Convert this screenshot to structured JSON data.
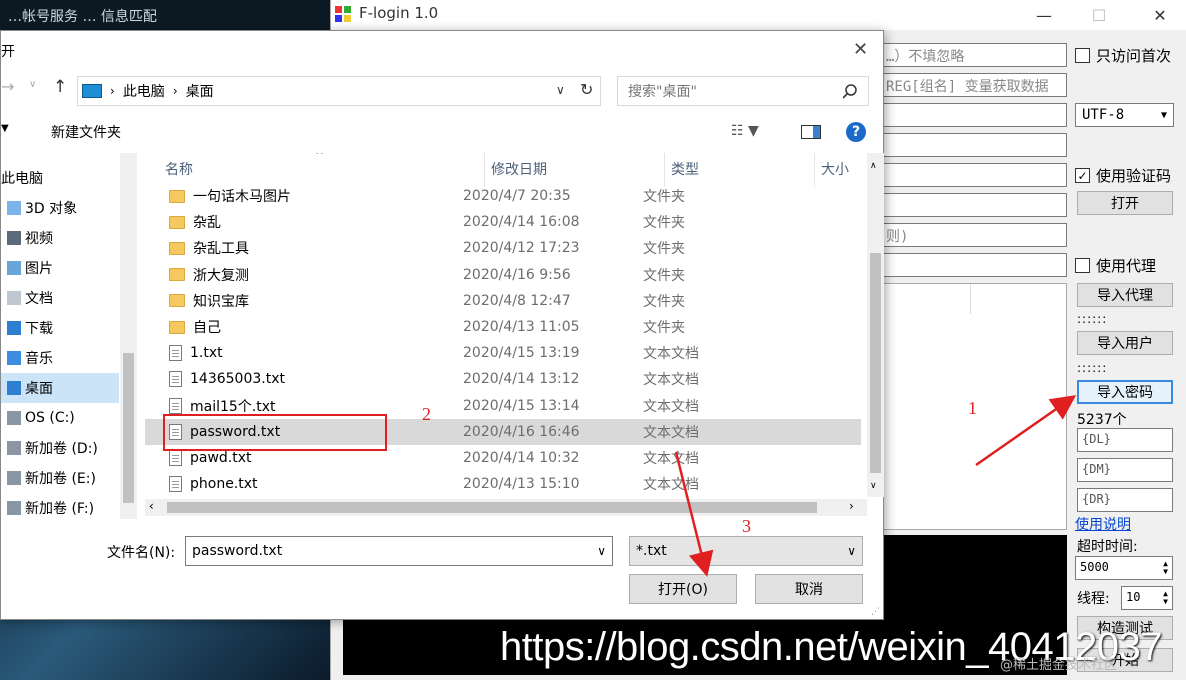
{
  "desktop": {
    "title_text": "…帐号服务 … 信息匹配"
  },
  "flogin": {
    "title": "F-login 1.0",
    "inputs": [
      "…）不填忽略",
      "REG[组名] 变量获取数据",
      "",
      "",
      "",
      "",
      "则)",
      ""
    ],
    "only_first": "只访问首次",
    "encoding": "UTF-8",
    "use_captcha": "使用验证码",
    "open_btn": "打开",
    "use_proxy": "使用代理",
    "import_proxy": "导入代理",
    "dots1": "::::::",
    "import_user": "导入用户",
    "dots2": "::::::",
    "import_pwd": "导入密码",
    "count": "5237个",
    "dl": "{DL}",
    "dm": "{DM}",
    "dr": "{DR}",
    "usage": "使用说明",
    "timeout_label": "超时时间:",
    "timeout_value": "5000",
    "threads_label": "线程:",
    "threads_value": "10",
    "build_test": "构造测试",
    "start": "开始"
  },
  "dialog": {
    "title": "开",
    "breadcrumb": [
      "此电脑",
      "桌面"
    ],
    "search_placeholder": "搜索\"桌面\"",
    "new_folder": "新建文件夹",
    "nav": [
      "此电脑",
      "3D 对象",
      "视频",
      "图片",
      "文档",
      "下载",
      "音乐",
      "桌面",
      "OS (C:)",
      "新加卷 (D:)",
      "新加卷 (E:)",
      "新加卷 (F:)"
    ],
    "columns": {
      "name": "名称",
      "date": "修改日期",
      "type": "类型",
      "size": "大小"
    },
    "files": [
      {
        "name": "一句话木马图片",
        "date": "2020/4/7 20:35",
        "type": "文件夹",
        "kind": "folder"
      },
      {
        "name": "杂乱",
        "date": "2020/4/14 16:08",
        "type": "文件夹",
        "kind": "folder"
      },
      {
        "name": "杂乱工具",
        "date": "2020/4/12 17:23",
        "type": "文件夹",
        "kind": "folder"
      },
      {
        "name": "浙大复测",
        "date": "2020/4/16 9:56",
        "type": "文件夹",
        "kind": "folder"
      },
      {
        "name": "知识宝库",
        "date": "2020/4/8 12:47",
        "type": "文件夹",
        "kind": "folder"
      },
      {
        "name": "自己",
        "date": "2020/4/13 11:05",
        "type": "文件夹",
        "kind": "folder"
      },
      {
        "name": "1.txt",
        "date": "2020/4/15 13:19",
        "type": "文本文档",
        "kind": "file"
      },
      {
        "name": "14365003.txt",
        "date": "2020/4/14 13:12",
        "type": "文本文档",
        "kind": "file"
      },
      {
        "name": "mail15个.txt",
        "date": "2020/4/15 13:14",
        "type": "文本文档",
        "kind": "file"
      },
      {
        "name": "password.txt",
        "date": "2020/4/16 16:46",
        "type": "文本文档",
        "kind": "file"
      },
      {
        "name": "pawd.txt",
        "date": "2020/4/14 10:32",
        "type": "文本文档",
        "kind": "file"
      },
      {
        "name": "phone.txt",
        "date": "2020/4/13 15:10",
        "type": "文本文档",
        "kind": "file"
      }
    ],
    "selected_file": "password.txt",
    "filename_label": "文件名(N):",
    "filename_value": "password.txt",
    "filter": "*.txt",
    "open_btn": "打开(O)",
    "cancel_btn": "取消"
  },
  "annotations": {
    "one": "1",
    "two": "2",
    "three": "3",
    "color": "#e02020"
  },
  "watermark": {
    "url": "https://blog.csdn.net/weixin_40412037",
    "community": "@稀土掘金技术社区"
  }
}
